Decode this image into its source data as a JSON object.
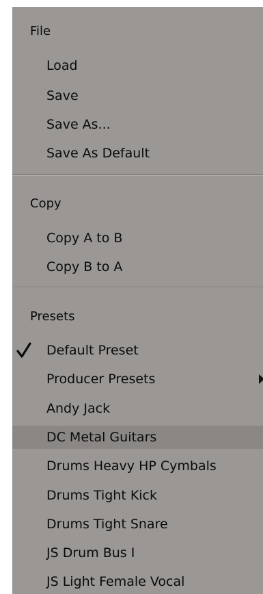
{
  "menu": {
    "file": {
      "header": "File",
      "items": [
        "Load",
        "Save",
        "Save As...",
        "Save As Default"
      ]
    },
    "copy": {
      "header": "Copy",
      "items": [
        "Copy A to B",
        "Copy B to A"
      ]
    },
    "presets": {
      "header": "Presets",
      "default_preset": "Default Preset",
      "producer_presets": "Producer Presets",
      "items": [
        "Andy Jack",
        "DC Metal Guitars",
        "Drums Heavy HP Cymbals",
        "Drums Tight Kick",
        "Drums Tight Snare",
        "JS Drum Bus I",
        "JS Light Female Vocal"
      ],
      "selected": "Default Preset",
      "hovered": "DC Metal Guitars"
    },
    "icons": {
      "checkmark": "checkmark-icon",
      "submenu": "chevron-right-icon"
    },
    "colors": {
      "background": "#9a9795",
      "highlight": "#8a8784",
      "separator": "#6f6c6a",
      "text": "#0b0b0b"
    }
  }
}
